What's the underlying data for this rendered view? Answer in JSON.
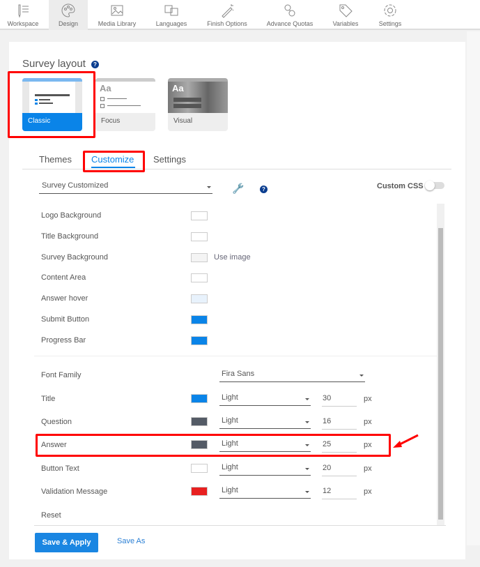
{
  "nav": [
    {
      "label": "Workspace",
      "icon": "workspace-icon"
    },
    {
      "label": "Design",
      "icon": "palette-icon",
      "active": true
    },
    {
      "label": "Media Library",
      "icon": "image-icon"
    },
    {
      "label": "Languages",
      "icon": "translate-icon"
    },
    {
      "label": "Finish Options",
      "icon": "magic-wand-icon"
    },
    {
      "label": "Advance Quotas",
      "icon": "link-icon"
    },
    {
      "label": "Variables",
      "icon": "tag-icon"
    },
    {
      "label": "Settings",
      "icon": "gear-icon"
    }
  ],
  "layout": {
    "title": "Survey layout",
    "help": "?",
    "cards": [
      {
        "label": "Classic",
        "selected": true
      },
      {
        "label": "Focus",
        "thumb": "Aa"
      },
      {
        "label": "Visual",
        "thumb": "Aa"
      }
    ]
  },
  "tabs": [
    {
      "label": "Themes"
    },
    {
      "label": "Customize",
      "active": true
    },
    {
      "label": "Settings"
    }
  ],
  "theme_select": "Survey Customized",
  "help": "?",
  "custom_css": {
    "label": "Custom CSS",
    "on": false
  },
  "colors": [
    {
      "label": "Logo Background",
      "color": "#ffffff"
    },
    {
      "label": "Title Background",
      "color": "#ffffff"
    },
    {
      "label": "Survey Background",
      "color": "#f4f4f4",
      "extra": "Use image"
    },
    {
      "label": "Content Area",
      "color": "#ffffff"
    },
    {
      "label": "Answer hover",
      "color": "#e8f2fc"
    },
    {
      "label": "Submit Button",
      "color": "#0a84e8"
    },
    {
      "label": "Progress Bar",
      "color": "#0a84e8"
    }
  ],
  "font_family": {
    "label": "Font Family",
    "value": "Fira Sans"
  },
  "fonts": [
    {
      "label": "Title",
      "color": "#0a84e8",
      "weight": "Light",
      "size": "30",
      "unit": "px"
    },
    {
      "label": "Question",
      "color": "#545b66",
      "weight": "Light",
      "size": "16",
      "unit": "px"
    },
    {
      "label": "Answer",
      "color": "#545b66",
      "weight": "Light",
      "size": "25",
      "unit": "px"
    },
    {
      "label": "Button Text",
      "color": "#ffffff",
      "weight": "Light",
      "size": "20",
      "unit": "px"
    },
    {
      "label": "Validation Message",
      "color": "#e82020",
      "weight": "Light",
      "size": "12",
      "unit": "px"
    }
  ],
  "reset": "Reset",
  "save_apply": "Save & Apply",
  "save_as": "Save As"
}
